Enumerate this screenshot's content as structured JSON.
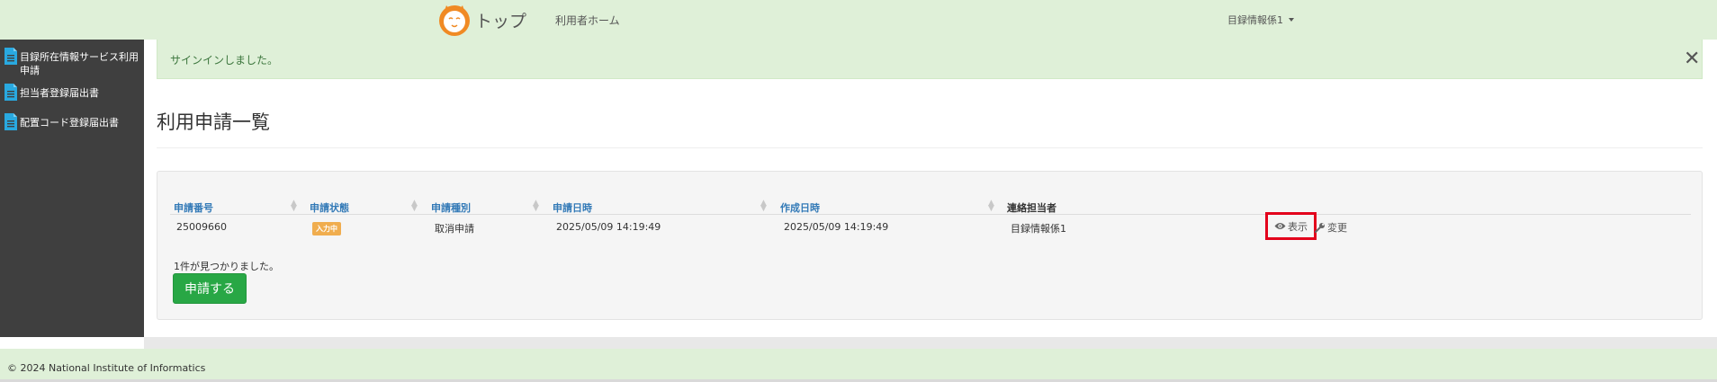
{
  "navbar": {
    "brand_label": "トップ",
    "home_link": "利用者ホーム",
    "user_name": "目録情報係1"
  },
  "sidebar": {
    "items": [
      {
        "label": "目録所在情報サービス利用申請"
      },
      {
        "label": "担当者登録届出書"
      },
      {
        "label": "配置コード登録届出書"
      }
    ]
  },
  "alert": {
    "message": "サインインしました。",
    "close_symbol": "✕"
  },
  "page": {
    "title": "利用申請一覧"
  },
  "table": {
    "columns": [
      "申請番号",
      "申請状態",
      "申請種別",
      "申請日時",
      "作成日時",
      "連絡担当者"
    ],
    "rows": [
      {
        "number": "25009660",
        "status": "入力中",
        "type": "取消申請",
        "applied_at": "2025/05/09 14:19:49",
        "created_at": "2025/05/09 14:19:49",
        "contact": "目録情報係1",
        "show_label": "表示",
        "edit_label": "変更"
      }
    ],
    "count_text": "1件が見つかりました。",
    "apply_button": "申請する"
  },
  "colors": {
    "header_bg": "#dff0d8",
    "sidebar_bg": "#3f3f3f",
    "link_blue": "#337ab7",
    "status_badge": "#f0ad4e",
    "apply_button": "#28a745",
    "highlight": "#e3001b"
  },
  "footer": {
    "copyright": "© 2024 National Institute of Informatics"
  }
}
